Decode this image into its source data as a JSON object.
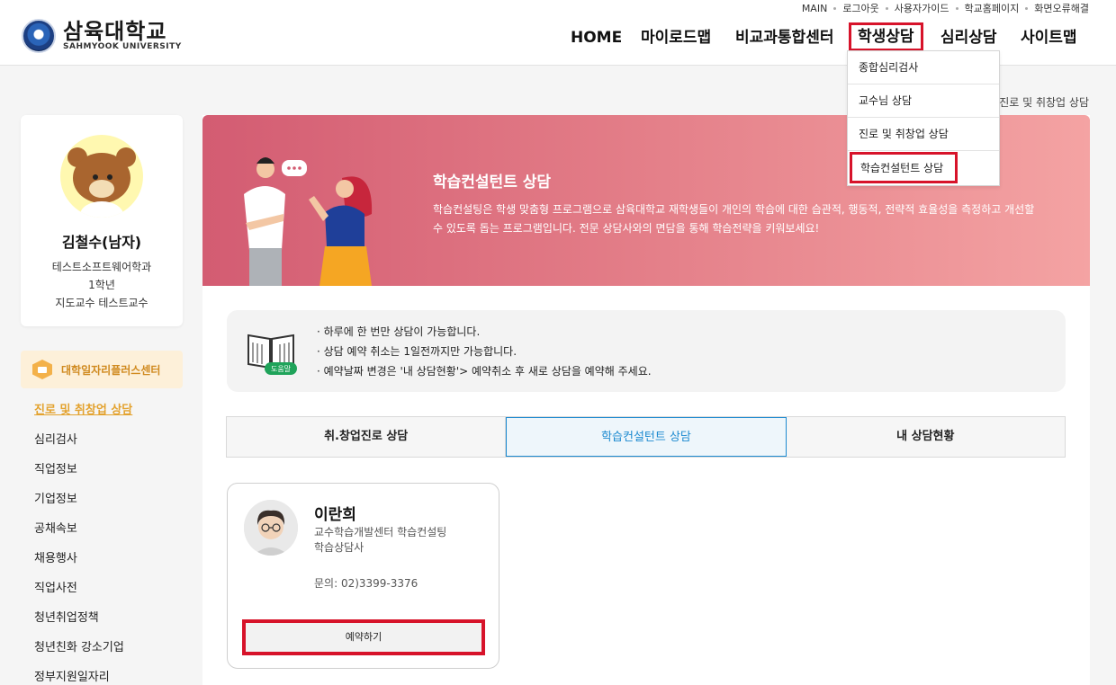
{
  "header": {
    "util_links": [
      "MAIN",
      "로그아웃",
      "사용자가이드",
      "학교홈페이지",
      "화면오류해결"
    ],
    "logo_kor": "삼육대학교",
    "logo_eng": "SAHMYOOK UNIVERSITY",
    "gnb": [
      "HOME",
      "마이로드맵",
      "비교과통합센터",
      "학생상담",
      "심리상담",
      "사이트맵"
    ],
    "gnb_active": "학생상담"
  },
  "dropdown": {
    "items": [
      "종합심리검사",
      "교수님 상담",
      "진로 및 취창업 상담",
      "학습컨설턴트 상담"
    ],
    "highlighted": "학습컨설턴트 상담"
  },
  "breadcrumb": "> 진로 및 취창업 상담",
  "profile": {
    "name": "김철수(남자)",
    "department": "테스트소프트웨어학과",
    "grade": "1학년",
    "advisor": "지도교수 테스트교수"
  },
  "sidebar": {
    "center_label": "대학일자리플러스센터",
    "menu": [
      "진로 및 취창업 상담",
      "심리검사",
      "직업정보",
      "기업정보",
      "공채속보",
      "채용행사",
      "직업사전",
      "청년취업정책",
      "청년친화 강소기업",
      "정부지원일자리"
    ],
    "active_menu": "진로 및 취창업 상담"
  },
  "hero": {
    "title": "학습컨설턴트 상담",
    "description": "학습컨설팅은 학생 맞춤형 프로그램으로 삼육대학교 재학생들이 개인의 학습에 대한 습관적, 행동적, 전략적 효율성을 측정하고 개선할 수 있도록 돕는 프로그램입니다. 전문 상담사와의 면담을 통해 학습전략을 키워보세요!"
  },
  "notice": {
    "badge": "도움말",
    "lines": [
      "· 하루에 한 번만 상담이 가능합니다.",
      "· 상담 예약 취소는 1일전까지만 가능합니다.",
      "· 예약날짜 변경은 '내 상담현황'> 예약취소 후 새로 상담을 예약해 주세요."
    ]
  },
  "tabs": [
    "취.창업진로 상담",
    "학습컨설턴트 상담",
    "내 상담현황"
  ],
  "tab_active": "학습컨설턴트 상담",
  "counselor": {
    "name": "이란희",
    "dept_line1": "교수학습개발센터 학습컨설팅",
    "dept_line2": "학습상담사",
    "phone": "문의: 02)3399-3376",
    "button": "예약하기"
  },
  "colors": {
    "highlight_red": "#d7132a",
    "accent_blue": "#1c8ad0",
    "sidebar_orange": "#e3a22e",
    "hero_pink": "#d35c72"
  }
}
